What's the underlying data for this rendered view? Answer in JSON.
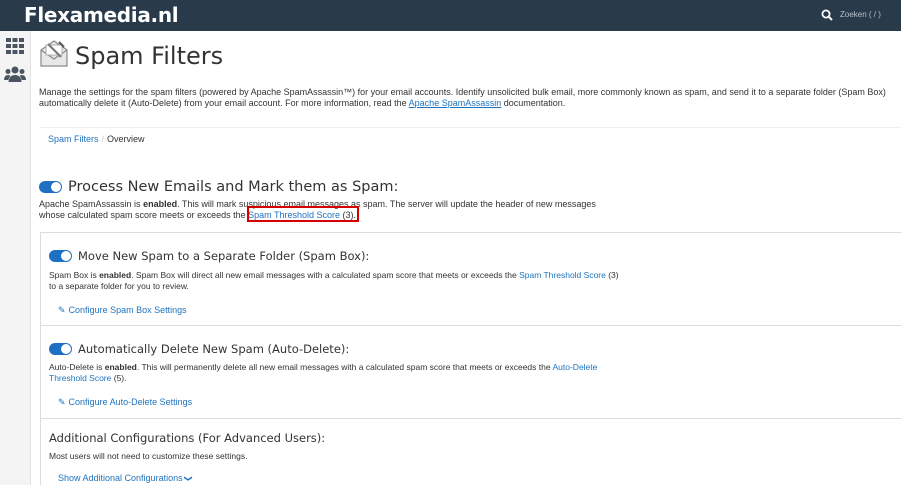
{
  "header": {
    "brand": "Flexamedia.nl",
    "search_placeholder": "Zoeken ( / )"
  },
  "sidebar": {
    "icons": [
      "grid-icon",
      "users-icon"
    ]
  },
  "page": {
    "title": "Spam Filters",
    "intro_1": "Manage the settings for the spam filters (powered by Apache SpamAssassin™) for your email accounts. Identify unsolicited bulk email, more commonly known as spam, and send it to a separate folder (Spam Box)",
    "intro_2_pre": "automatically delete it (Auto-Delete) from your email account. For more information, read the ",
    "intro_link": "Apache SpamAssassin",
    "intro_2_post": " documentation."
  },
  "breadcrumb": {
    "link": "Spam Filters",
    "separator": "/",
    "current": "Overview"
  },
  "process": {
    "title": "Process New Emails and Mark them as Spam:",
    "desc_1_pre": "Apache SpamAssassin is ",
    "desc_1_bold": "enabled",
    "desc_1_post": ". This will mark suspicious email messages as spam. The server will update the header of new messages",
    "desc_2_pre": "whose calculated spam score meets or exceeds the ",
    "desc_2_link": "Spam Threshold Score",
    "desc_2_post": " (3)."
  },
  "spam_box": {
    "title": "Move New Spam to a Separate Folder (Spam Box):",
    "desc_pre": "Spam Box is ",
    "desc_bold": "enabled",
    "desc_mid": ". Spam Box will direct all new email messages with a calculated spam score that meets or exceeds the ",
    "desc_link": "Spam Threshold Score",
    "desc_post": " (3) to a separate folder for you to review.",
    "link": "Configure Spam Box Settings"
  },
  "auto_delete": {
    "title": "Automatically Delete New Spam (Auto-Delete):",
    "desc_pre": "Auto-Delete is ",
    "desc_bold": "enabled",
    "desc_mid": ". This will permanently delete all new email messages with a calculated spam score that meets or exceeds the ",
    "desc_link": "Auto-Delete Threshold Score",
    "desc_post": " (5).",
    "link": "Configure Auto-Delete Settings"
  },
  "advanced": {
    "title": "Additional Configurations (For Advanced Users):",
    "desc": "Most users will not need to customize these settings.",
    "link": "Show Additional Configurations"
  },
  "colors": {
    "topbar": "#293a4a",
    "link": "#1e73be",
    "toggle_on": "#1f70c2",
    "highlight_box": "#d40000"
  }
}
